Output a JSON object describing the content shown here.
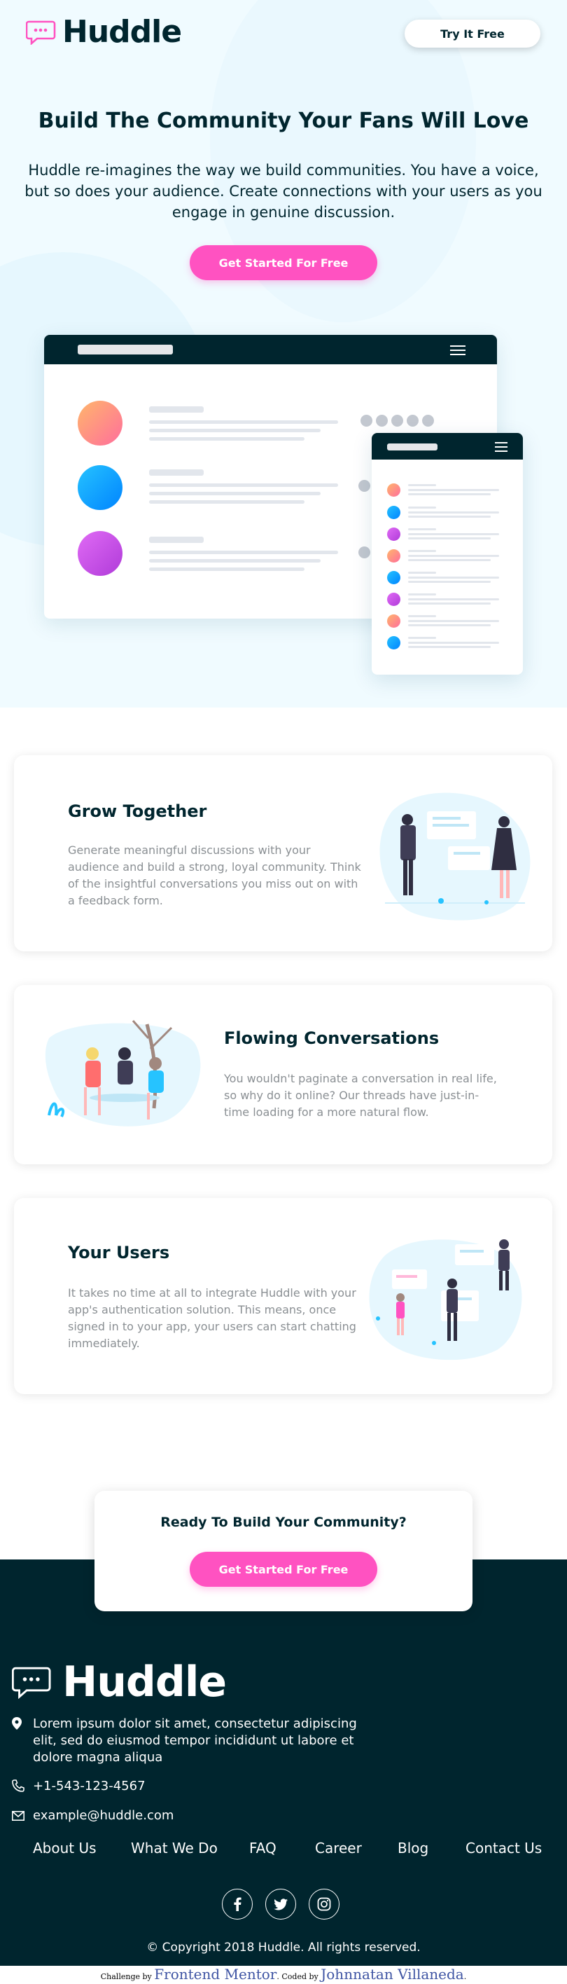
{
  "header": {
    "logo_text": "Huddle",
    "try_button": "Try It Free"
  },
  "hero": {
    "title": "Build The Community Your Fans Will Love",
    "description": "Huddle re-imagines the way we build communities. You have a voice, but so does your audience. Create connections with your users as you engage in genuine discussion.",
    "cta_label": "Get Started For Free"
  },
  "colors": {
    "dark": "#00252e",
    "pink": "#ff52c1",
    "hero_bg": "#f0fbff"
  },
  "features": [
    {
      "title": "Grow Together",
      "text": "Generate meaningful discussions with your audience and build a strong, loyal community. Think of the insightful conversations you miss out on with a feedback form."
    },
    {
      "title": "Flowing Conversations",
      "text": "You wouldn't paginate a conversation in real life, so why do it online? Our threads have just-in-time loading for a more natural flow."
    },
    {
      "title": "Your Users",
      "text": "It takes no time at all to integrate Huddle with your app's authentication solution. This means, once signed in to your app, your users can start chatting immediately."
    }
  ],
  "cta": {
    "title": "Ready To Build Your Community?",
    "button": "Get Started For Free"
  },
  "footer": {
    "logo_text": "Huddle",
    "address": "Lorem ipsum dolor sit amet, consectetur adipiscing elit, sed do eiusmod tempor incididunt ut labore et dolore magna aliqua",
    "phone": "+1-543-123-4567",
    "email": "example@huddle.com",
    "nav": [
      "About Us",
      "What We Do",
      "FAQ",
      "Career",
      "Blog",
      "Contact Us"
    ],
    "socials": [
      "facebook-icon",
      "twitter-icon",
      "instagram-icon"
    ],
    "copyright": "© Copyright 2018 Huddle. All rights reserved."
  },
  "attribution": {
    "challenge_prefix": "Challenge by",
    "challenge_link": "Frontend Mentor",
    "coded_prefix": "Coded by",
    "coded_link": "Johnnatan Villaneda"
  }
}
